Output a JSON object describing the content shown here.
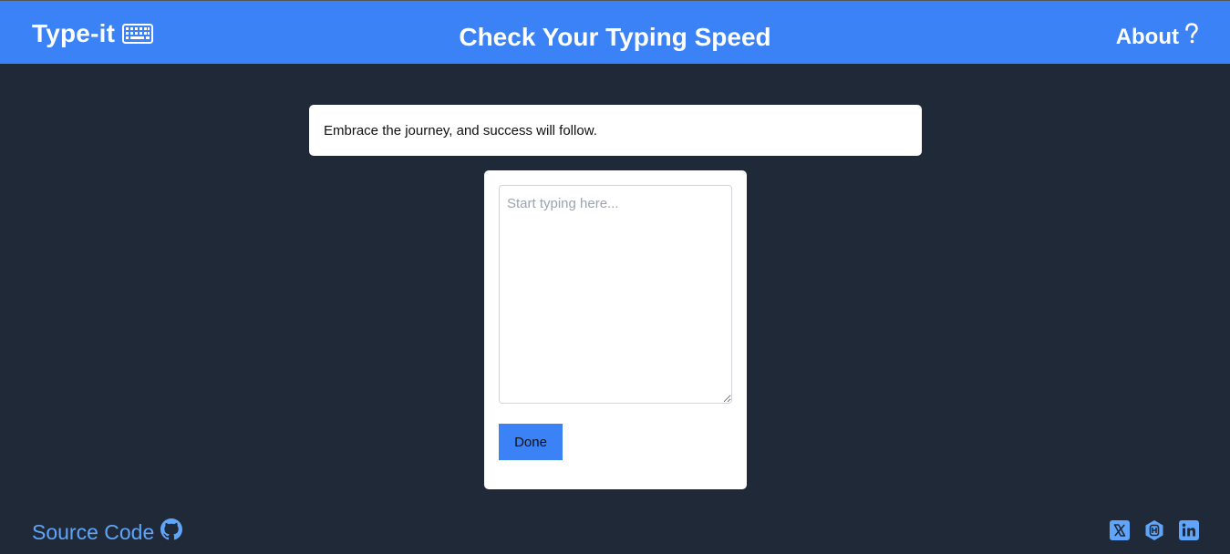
{
  "header": {
    "brand": "Type-it",
    "brand_icon": "keyboard-icon",
    "title": "Check Your Typing Speed",
    "about_label": "About",
    "about_icon": "question-mark-icon"
  },
  "quote": {
    "text": "Embrace the journey, and success will follow."
  },
  "typing": {
    "placeholder": "Start typing here...",
    "value": "",
    "done_label": "Done"
  },
  "footer": {
    "source_label": "Source Code",
    "source_icon": "github-icon",
    "social_icons": [
      "x-twitter-icon",
      "hashnode-icon",
      "linkedin-icon"
    ]
  },
  "colors": {
    "header_bg": "#3b82f6",
    "page_bg": "#1f2937",
    "accent": "#3b82f6",
    "link": "#60a5fa"
  }
}
